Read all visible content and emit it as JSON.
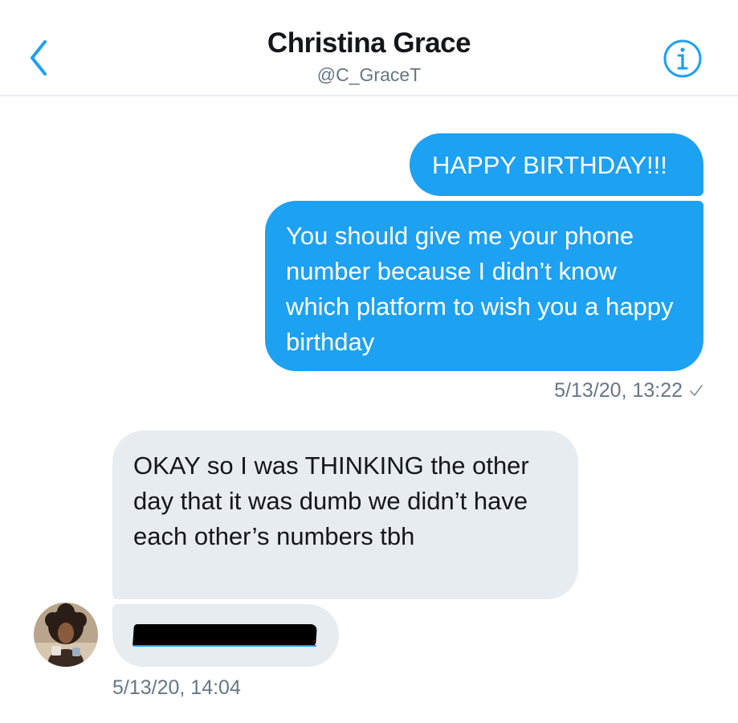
{
  "header": {
    "title": "Christina Grace",
    "handle": "@C_GraceT",
    "back_icon": "chevron-left-icon",
    "info_icon": "info-circle-icon",
    "accent_color": "#1da1f2"
  },
  "messages": {
    "outgoing": [
      {
        "text": "HAPPY BIRTHDAY!!!"
      },
      {
        "text": "You should give me your phone number because I didn’t know which platform to wish you a happy birthday"
      }
    ],
    "outgoing_time": "5/13/20, 13:22",
    "outgoing_status_icon": "checkmark-icon",
    "incoming": [
      {
        "text": "OKAY so I was THINKING the other day that it was dumb we didn’t have each other’s numbers tbh"
      }
    ],
    "incoming_time": "5/13/20, 14:04"
  },
  "colors": {
    "outgoing_bubble": "#1da1f2",
    "incoming_bubble": "#e6ecf0",
    "meta_text": "#657786"
  }
}
